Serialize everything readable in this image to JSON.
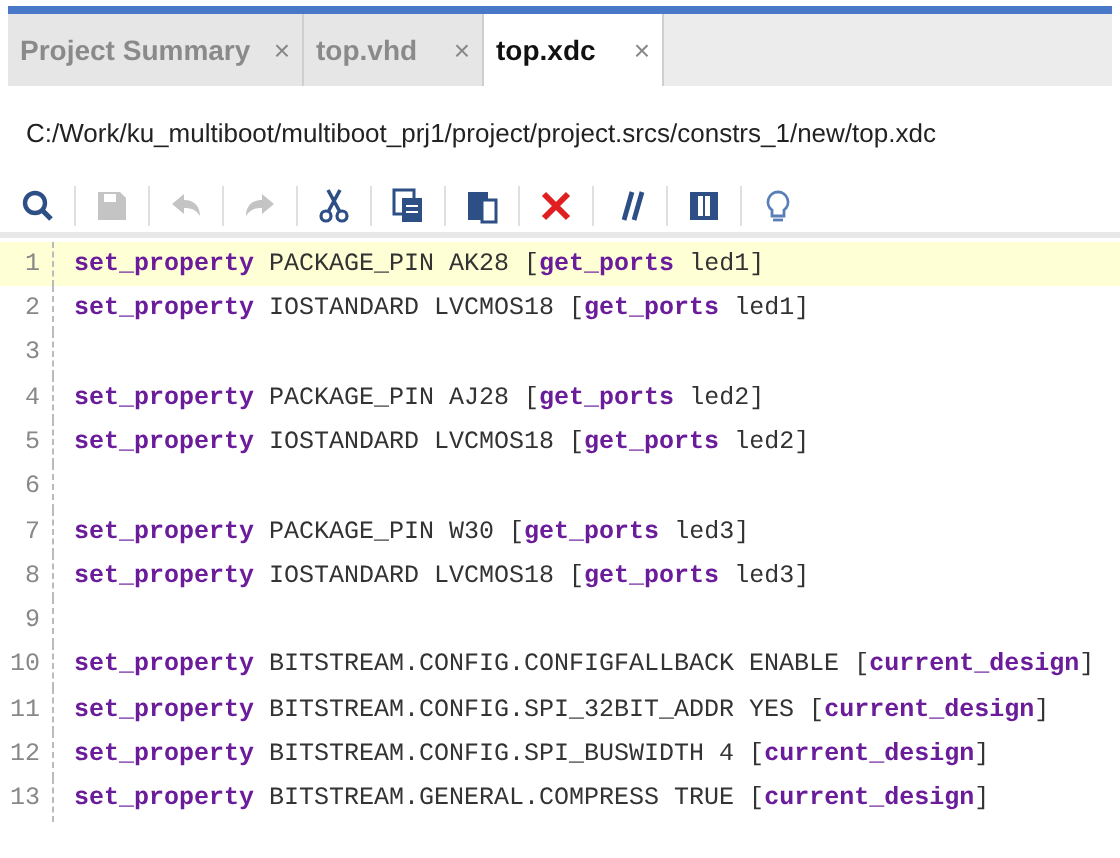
{
  "tabs": [
    {
      "label": "Project Summary",
      "close": "×",
      "selected": false
    },
    {
      "label": "top.vhd",
      "close": "×",
      "selected": false
    },
    {
      "label": "top.xdc",
      "close": "×",
      "selected": true
    }
  ],
  "file_path": "C:/Work/ku_multiboot/multiboot_prj1/project/project.srcs/constrs_1/new/top.xdc",
  "toolbar": [
    {
      "kind": "search",
      "disabled": false
    },
    {
      "kind": "save",
      "disabled": true
    },
    {
      "kind": "undo",
      "disabled": true
    },
    {
      "kind": "redo",
      "disabled": true
    },
    {
      "kind": "cut",
      "disabled": false
    },
    {
      "kind": "copy",
      "disabled": false
    },
    {
      "kind": "paste",
      "disabled": false
    },
    {
      "kind": "delete",
      "disabled": false
    },
    {
      "kind": "comment",
      "disabled": false
    },
    {
      "kind": "columns",
      "disabled": false
    },
    {
      "kind": "hint",
      "disabled": false
    }
  ],
  "code_lines": [
    {
      "number": "1",
      "current": true,
      "tokens": [
        {
          "kind": "keyword",
          "text": "set_property"
        },
        {
          "kind": "text",
          "text": " PACKAGE_PIN AK28 ["
        },
        {
          "kind": "keyword",
          "text": "get_ports"
        },
        {
          "kind": "text",
          "text": " led1]"
        }
      ]
    },
    {
      "number": "2",
      "current": false,
      "tokens": [
        {
          "kind": "keyword",
          "text": "set_property"
        },
        {
          "kind": "text",
          "text": " IOSTANDARD LVCMOS18 ["
        },
        {
          "kind": "keyword",
          "text": "get_ports"
        },
        {
          "kind": "text",
          "text": " led1]"
        }
      ]
    },
    {
      "number": "3",
      "current": false
    },
    {
      "number": "4",
      "current": false,
      "tokens": [
        {
          "kind": "keyword",
          "text": "set_property"
        },
        {
          "kind": "text",
          "text": " PACKAGE_PIN AJ28 ["
        },
        {
          "kind": "keyword",
          "text": "get_ports"
        },
        {
          "kind": "text",
          "text": " led2]"
        }
      ]
    },
    {
      "number": "5",
      "current": false,
      "tokens": [
        {
          "kind": "keyword",
          "text": "set_property"
        },
        {
          "kind": "text",
          "text": " IOSTANDARD LVCMOS18 ["
        },
        {
          "kind": "keyword",
          "text": "get_ports"
        },
        {
          "kind": "text",
          "text": " led2]"
        }
      ]
    },
    {
      "number": "6",
      "current": false
    },
    {
      "number": "7",
      "current": false,
      "tokens": [
        {
          "kind": "keyword",
          "text": "set_property"
        },
        {
          "kind": "text",
          "text": " PACKAGE_PIN W30 ["
        },
        {
          "kind": "keyword",
          "text": "get_ports"
        },
        {
          "kind": "text",
          "text": " led3]"
        }
      ]
    },
    {
      "number": "8",
      "current": false,
      "tokens": [
        {
          "kind": "keyword",
          "text": "set_property"
        },
        {
          "kind": "text",
          "text": " IOSTANDARD LVCMOS18 ["
        },
        {
          "kind": "keyword",
          "text": "get_ports"
        },
        {
          "kind": "text",
          "text": " led3]"
        }
      ]
    },
    {
      "number": "9",
      "current": false
    },
    {
      "number": "10",
      "current": false,
      "tokens": [
        {
          "kind": "keyword",
          "text": "set_property"
        },
        {
          "kind": "text",
          "text": " BITSTREAM.CONFIG.CONFIGFALLBACK ENABLE ["
        },
        {
          "kind": "keyword",
          "text": "current_design"
        },
        {
          "kind": "text",
          "text": "]"
        }
      ]
    },
    {
      "number": "11",
      "current": false,
      "tokens": [
        {
          "kind": "keyword",
          "text": "set_property"
        },
        {
          "kind": "text",
          "text": " BITSTREAM.CONFIG.SPI_32BIT_ADDR YES ["
        },
        {
          "kind": "keyword",
          "text": "current_design"
        },
        {
          "kind": "text",
          "text": "]"
        }
      ]
    },
    {
      "number": "12",
      "current": false,
      "tokens": [
        {
          "kind": "keyword",
          "text": "set_property"
        },
        {
          "kind": "text",
          "text": " BITSTREAM.CONFIG.SPI_BUSWIDTH 4 ["
        },
        {
          "kind": "keyword",
          "text": "current_design"
        },
        {
          "kind": "text",
          "text": "]"
        }
      ]
    },
    {
      "number": "13",
      "current": false,
      "tokens": [
        {
          "kind": "keyword",
          "text": "set_property"
        },
        {
          "kind": "text",
          "text": " BITSTREAM.GENERAL.COMPRESS TRUE ["
        },
        {
          "kind": "keyword",
          "text": "current_design"
        },
        {
          "kind": "text",
          "text": "]"
        }
      ]
    }
  ]
}
